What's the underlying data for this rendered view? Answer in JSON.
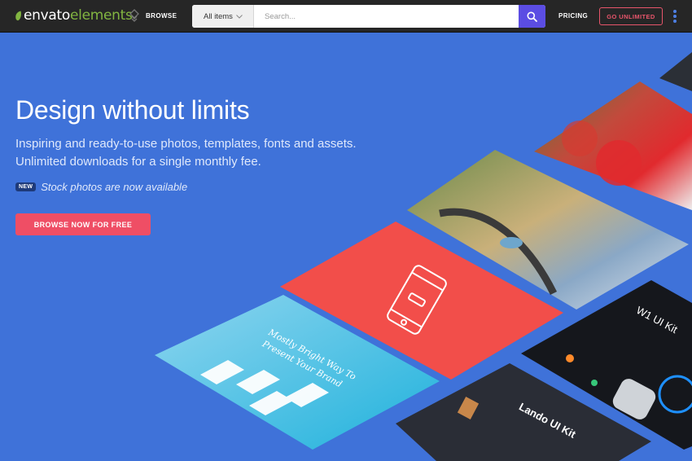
{
  "header": {
    "logo_primary": "envato",
    "logo_secondary": "elements",
    "browse_label": "BROWSE",
    "category_label": "All items",
    "search_placeholder": "Search...",
    "pricing_label": "PRICING",
    "go_unlimited_label": "GO UNLIMITED"
  },
  "hero": {
    "title": "Design without limits",
    "subtitle_line1": "Inspiring and ready-to-use photos, templates, fonts and assets.",
    "subtitle_line2": "Unlimited downloads for a single monthly fee.",
    "new_badge": "NEW",
    "new_text": "Stock photos are now available",
    "cta_label": "BROWSE NOW FOR FREE"
  },
  "tiles": {
    "ui_kit_label": "W1 UI Kit",
    "lando_label": "Lando UI Kit",
    "brand_label_line1": "Mostly Bright Way To",
    "brand_label_line2": "Present Your Brand"
  },
  "colors": {
    "background": "#3f72d9",
    "topbar": "#262626",
    "logo_green": "#82b541",
    "search_button": "#5b4de3",
    "accent_red": "#ef4e65",
    "outline_red": "#e8556b"
  },
  "icons": {
    "logo": "leaf-icon",
    "browse": "grid-icon",
    "category": "chevron-down-icon",
    "search": "search-icon",
    "menu": "kebab-menu-icon"
  }
}
